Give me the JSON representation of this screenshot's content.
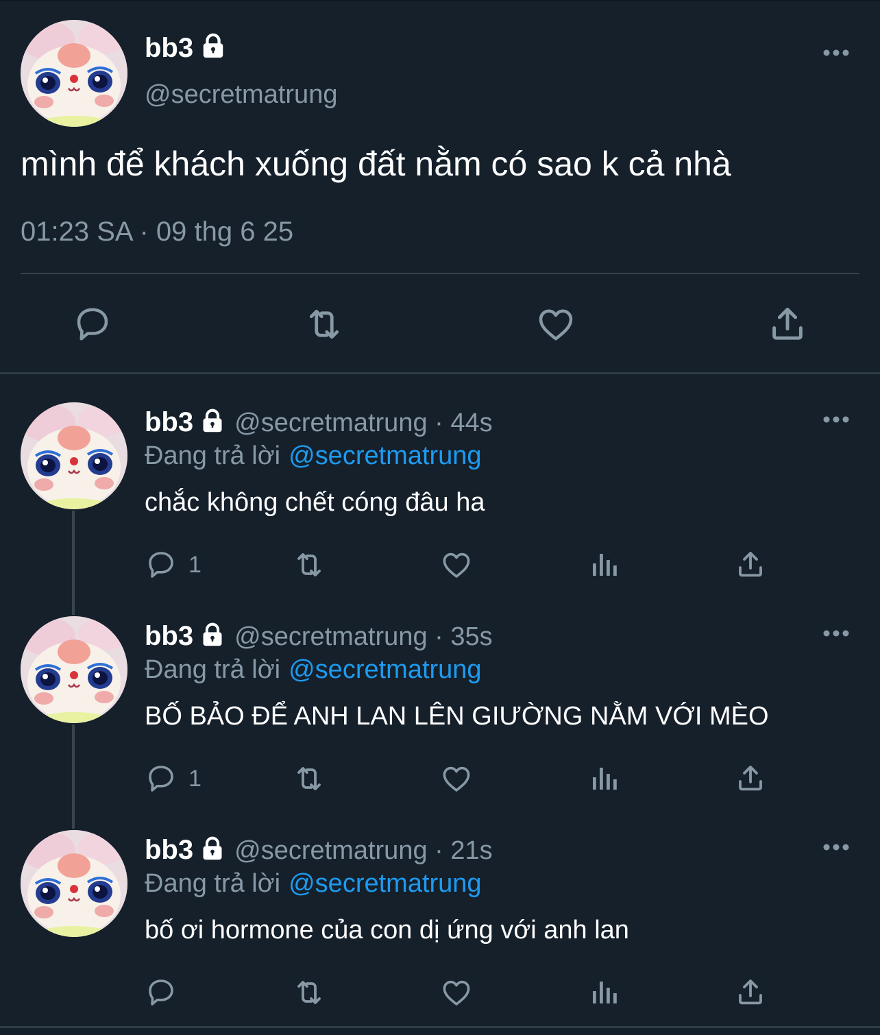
{
  "main_tweet": {
    "name": "bb3",
    "handle": "@secretmatrung",
    "text": "mình để khách xuống đất nằm có sao k cả nhà",
    "timestamp": "01:23 SA · 09 thg 6 25"
  },
  "replies": [
    {
      "name": "bb3",
      "handle_time": "@secretmatrung · 44s",
      "replying_label": "Đang trả lời",
      "replying_to": "@secretmatrung",
      "text": "chắc không chết cóng đâu ha",
      "reply_count": "1"
    },
    {
      "name": "bb3",
      "handle_time": "@secretmatrung · 35s",
      "replying_label": "Đang trả lời",
      "replying_to": "@secretmatrung",
      "text": "BỐ BẢO ĐỂ ANH LAN LÊN GIƯỜNG NẰM VỚI MÈO",
      "reply_count": "1"
    },
    {
      "name": "bb3",
      "handle_time": "@secretmatrung · 21s",
      "replying_label": "Đang trả lời",
      "replying_to": "@secretmatrung",
      "text": "bố ơi hormone của con dị ứng với anh lan",
      "reply_count": ""
    }
  ],
  "icons": [
    "lock-icon",
    "more-icon",
    "reply-icon",
    "retweet-icon",
    "like-icon",
    "share-icon",
    "views-icon"
  ],
  "colors": {
    "background": "#15202b",
    "secondary_text": "#8899a6",
    "mention": "#1d9bf0",
    "divider": "#38444d"
  }
}
